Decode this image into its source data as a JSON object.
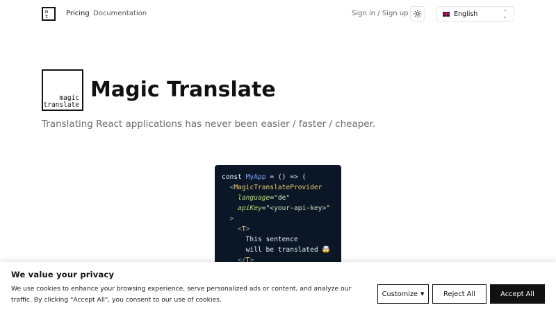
{
  "nav": {
    "logo_text": "mt",
    "links": [
      {
        "label": "Pricing"
      },
      {
        "label": "Documentation"
      }
    ],
    "signin_label": "Sign in / Sign up",
    "language": {
      "selected": "English",
      "flag": "uk-flag"
    }
  },
  "hero": {
    "logo_lines": [
      "magic",
      "translate"
    ],
    "title": "Magic Translate",
    "subtitle": "Translating React applications has never been easier / faster / cheaper."
  },
  "code": {
    "lines": [
      {
        "parts": [
          {
            "t": "const ",
            "c": "kw"
          },
          {
            "t": "MyApp",
            "c": "fn"
          },
          {
            "t": " = () => (",
            "c": "kw"
          }
        ]
      },
      {
        "parts": [
          {
            "t": "  <",
            "c": "pun"
          },
          {
            "t": "MagicTranslateProvider",
            "c": "tag"
          }
        ]
      },
      {
        "parts": [
          {
            "t": "    ",
            "c": "kw"
          },
          {
            "t": "language",
            "c": "attr"
          },
          {
            "t": "=",
            "c": "kw"
          },
          {
            "t": "\"de\"",
            "c": "str"
          }
        ]
      },
      {
        "parts": [
          {
            "t": "    ",
            "c": "kw"
          },
          {
            "t": "apiKey",
            "c": "attr"
          },
          {
            "t": "=",
            "c": "kw"
          },
          {
            "t": "\"<your-api-key>\"",
            "c": "str"
          }
        ]
      },
      {
        "parts": [
          {
            "t": "  >",
            "c": "pun"
          }
        ]
      },
      {
        "parts": [
          {
            "t": "    <",
            "c": "pun"
          },
          {
            "t": "T",
            "c": "tag"
          },
          {
            "t": ">",
            "c": "pun"
          }
        ]
      },
      {
        "parts": [
          {
            "t": "      This sentence",
            "c": "kw"
          }
        ]
      },
      {
        "parts": [
          {
            "t": "      will be translated 🤯",
            "c": "kw"
          }
        ]
      },
      {
        "parts": [
          {
            "t": "    </",
            "c": "pun"
          },
          {
            "t": "T",
            "c": "tag"
          },
          {
            "t": ">",
            "c": "pun"
          }
        ]
      }
    ]
  },
  "cookie": {
    "title": "We value your privacy",
    "text": "We use cookies to enhance your browsing experience, serve personalized ads or content, and analyze our traffic. By clicking \"Accept All\", you consent to our use of cookies.",
    "customize_label": "Customize",
    "reject_label": "Reject All",
    "accept_label": "Accept All"
  }
}
